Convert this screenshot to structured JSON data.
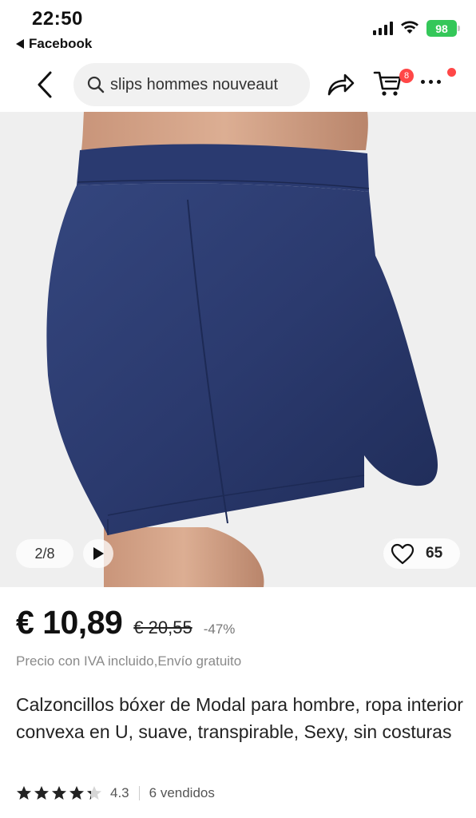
{
  "status_bar": {
    "time": "22:50",
    "back_app": "Facebook",
    "battery": "98"
  },
  "nav": {
    "search_text": "slips hommes nouveaut",
    "cart_count": "8",
    "icons": [
      "back-icon",
      "search-icon",
      "share-icon",
      "cart-icon",
      "more-icon"
    ]
  },
  "gallery": {
    "counter": "2/8",
    "wishlist_count": "65",
    "product_color": "#2b3a6e"
  },
  "price": {
    "current": "€ 10,89",
    "original": "€ 20,55",
    "discount": "-47%",
    "tax_note": "Precio con IVA incluido,Envío gratuito"
  },
  "product": {
    "title": "Calzoncillos bóxer de Modal para hombre, ropa interior convexa en U, suave, transpirable, Sexy, sin costuras",
    "rating": "4.3",
    "rating_stars": 4.3,
    "sold": "6 vendidos"
  },
  "colors": {
    "accent": "#ff4747",
    "battery": "#34c759"
  }
}
